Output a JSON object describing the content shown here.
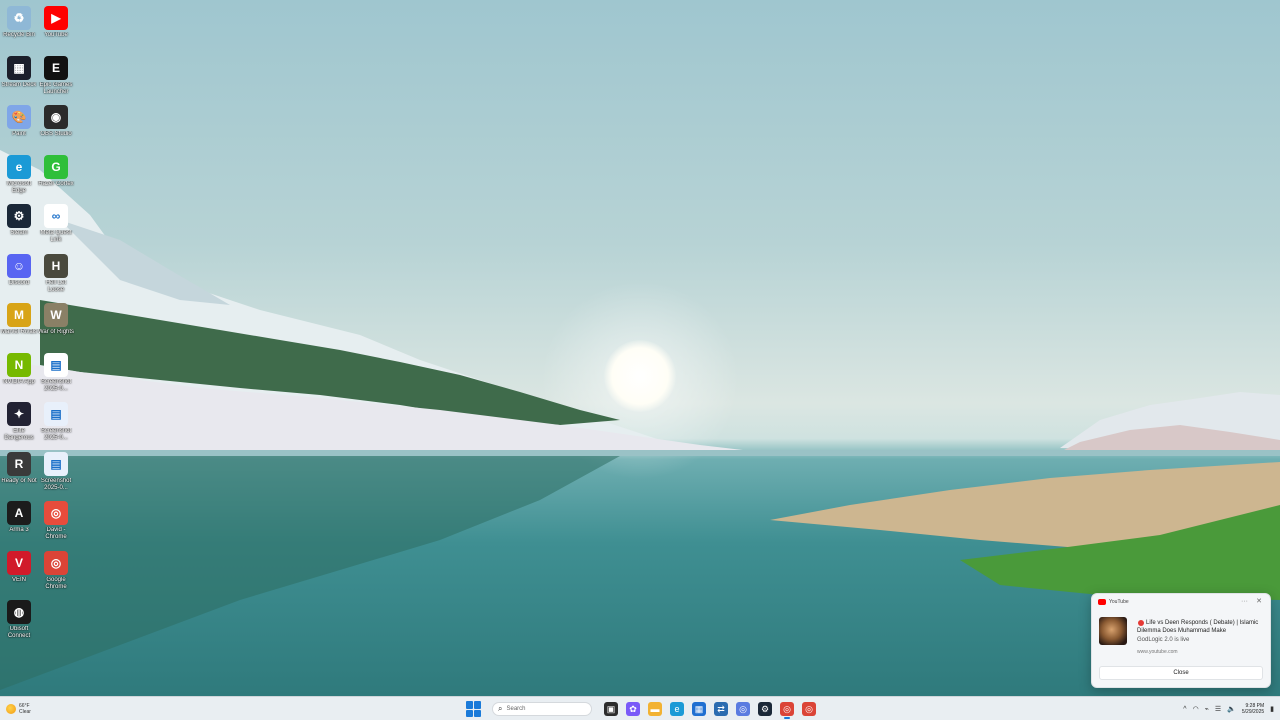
{
  "desktop": {
    "icons": [
      {
        "label": "Recycle Bin",
        "icon": "recycle-bin-icon",
        "color": "#8fb8d6",
        "glyph": "♻"
      },
      {
        "label": "YouTube",
        "icon": "youtube-icon",
        "color": "#ff0000",
        "glyph": "▶"
      },
      {
        "label": "Stream Deck",
        "icon": "stream-deck-icon",
        "color": "#1c1f2b",
        "glyph": "▦"
      },
      {
        "label": "Epic Games Launcher",
        "icon": "epic-games-icon",
        "color": "#111111",
        "glyph": "E"
      },
      {
        "label": "Paint",
        "icon": "paint-icon",
        "color": "#7fa6e8",
        "glyph": "🎨"
      },
      {
        "label": "OBS Studio",
        "icon": "obs-icon",
        "color": "#2b2b2b",
        "glyph": "◉"
      },
      {
        "label": "Microsoft Edge",
        "icon": "edge-icon",
        "color": "#1b9ad6",
        "glyph": "e"
      },
      {
        "label": "Razer Cortex",
        "icon": "razer-cortex-icon",
        "color": "#2fbf3a",
        "glyph": "G"
      },
      {
        "label": "Steam",
        "icon": "steam-icon",
        "color": "#1b2838",
        "glyph": "⚙"
      },
      {
        "label": "Meta Quest Link",
        "icon": "meta-icon",
        "color": "#ffffff",
        "glyph": "∞"
      },
      {
        "label": "Discord",
        "icon": "discord-icon",
        "color": "#5865f2",
        "glyph": "☺"
      },
      {
        "label": "Hell Let Loose",
        "icon": "hell-let-loose-icon",
        "color": "#4a4a3e",
        "glyph": "H"
      },
      {
        "label": "Marvel Rivals",
        "icon": "marvel-rivals-icon",
        "color": "#d8a417",
        "glyph": "M"
      },
      {
        "label": "War of Rights",
        "icon": "war-of-rights-icon",
        "color": "#8a8066",
        "glyph": "W"
      },
      {
        "label": "NVIDIA App",
        "icon": "nvidia-icon",
        "color": "#76b900",
        "glyph": "N"
      },
      {
        "label": "Screenshot 2025-0...",
        "icon": "screenshot-file-icon",
        "color": "#ffffff",
        "glyph": "▤"
      },
      {
        "label": "Elite Dangerous",
        "icon": "elite-dangerous-icon",
        "color": "#222233",
        "glyph": "✦"
      },
      {
        "label": "Screenshot 2025-0...",
        "icon": "screenshot-file-icon",
        "color": "#e8f0fb",
        "glyph": "▤"
      },
      {
        "label": "Ready or Not",
        "icon": "ready-or-not-icon",
        "color": "#3a3a3a",
        "glyph": "R"
      },
      {
        "label": "Screenshot 2025-0...",
        "icon": "screenshot-file-icon",
        "color": "#e8f0fb",
        "glyph": "▤"
      },
      {
        "label": "Arma 3",
        "icon": "arma-icon",
        "color": "#1c1c1c",
        "glyph": "A"
      },
      {
        "label": "David - Chrome",
        "icon": "chrome-profile-icon",
        "color": "#e74c3c",
        "glyph": "◎"
      },
      {
        "label": "VEIN",
        "icon": "vein-icon",
        "color": "#d11a2a",
        "glyph": "V"
      },
      {
        "label": "Google Chrome",
        "icon": "chrome-icon",
        "color": "#db4437",
        "glyph": "◎"
      },
      {
        "label": "Ubisoft Connect",
        "icon": "ubisoft-icon",
        "color": "#1a1a1a",
        "glyph": "◍"
      }
    ]
  },
  "taskbar": {
    "weather": {
      "temp": "66°F",
      "condition": "Clear"
    },
    "search_placeholder": "Search",
    "apps": [
      {
        "name": "taskbar-task-view",
        "icon": "task-view-icon",
        "color": "#2d2d2d",
        "glyph": "▣",
        "active": false
      },
      {
        "name": "taskbar-copilot",
        "icon": "copilot-icon",
        "color": "#7a5af8",
        "glyph": "✿",
        "active": false
      },
      {
        "name": "taskbar-file-explorer",
        "icon": "folder-icon",
        "color": "#f2b233",
        "glyph": "▬",
        "active": false
      },
      {
        "name": "taskbar-edge",
        "icon": "edge-icon",
        "color": "#1b9ad6",
        "glyph": "e",
        "active": false
      },
      {
        "name": "taskbar-store",
        "icon": "store-icon",
        "color": "#1f6fd1",
        "glyph": "▦",
        "active": false
      },
      {
        "name": "taskbar-remote",
        "icon": "remote-desktop-icon",
        "color": "#2b6cb0",
        "glyph": "⇄",
        "active": false
      },
      {
        "name": "taskbar-chrome-profile",
        "icon": "chrome-profile-icon",
        "color": "#5a7be0",
        "glyph": "◎",
        "active": false
      },
      {
        "name": "taskbar-steam",
        "icon": "steam-icon",
        "color": "#1b2838",
        "glyph": "⚙",
        "active": false
      },
      {
        "name": "taskbar-chrome",
        "icon": "chrome-icon",
        "color": "#db4437",
        "glyph": "◎",
        "active": true
      },
      {
        "name": "taskbar-chrome-2",
        "icon": "chrome-icon",
        "color": "#db4437",
        "glyph": "◎",
        "active": false
      }
    ],
    "tray": {
      "chevron": "^",
      "time": "9:28 PM",
      "date": "5/29/2025"
    }
  },
  "notification": {
    "app": "YouTube",
    "title": "Life vs Deen Responds ( Debate) | Islamic Dilemma Does Muhammad Make",
    "subtitle": "GodLogic 2.0 is live",
    "source": "www.youtube.com",
    "close_label": "Close",
    "more": "···",
    "dismiss": "✕"
  }
}
